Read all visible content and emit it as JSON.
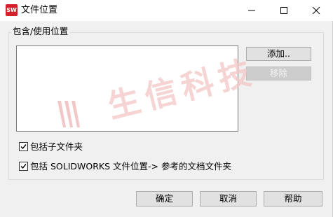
{
  "window": {
    "app_icon_text": "SW",
    "title": "文件位置",
    "accent_color": "#d4202a"
  },
  "titlebar_buttons": {
    "minimize_icon": "minimize-icon",
    "maximize_icon": "maximize-icon",
    "close_icon": "close-icon"
  },
  "group": {
    "label": "包含/使用位置",
    "locations": []
  },
  "side_buttons": {
    "add_label": "添加..",
    "remove_label": "移除"
  },
  "options": [
    {
      "label": "包括子文件夹",
      "checked": true
    },
    {
      "label": "包括 SOLIDWORKS 文件位置-> 参考的文档文件夹",
      "checked": true
    }
  ],
  "footer_buttons": {
    "ok_label": "确定",
    "cancel_label": "取消",
    "help_label": "帮助"
  },
  "watermark": {
    "text": "生信科技",
    "color": "#f3c6c6"
  }
}
